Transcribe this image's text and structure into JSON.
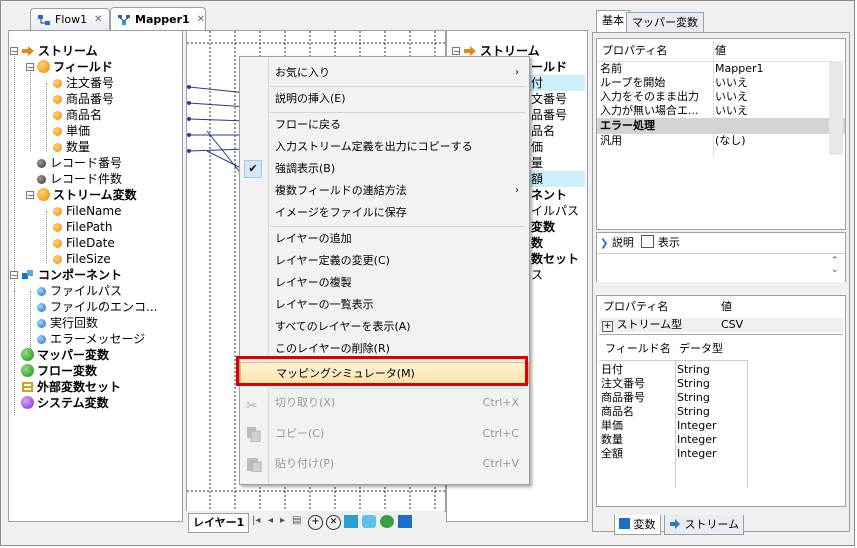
{
  "tabs": [
    {
      "label": "Flow1",
      "active": false
    },
    {
      "label": "Mapper1",
      "active": true
    }
  ],
  "left_tree": [
    {
      "label": "ストリーム",
      "bold": true
    },
    {
      "label": "フィールド",
      "bold": true
    },
    {
      "label": "注文番号"
    },
    {
      "label": "商品番号"
    },
    {
      "label": "商品名"
    },
    {
      "label": "単価"
    },
    {
      "label": "数量"
    },
    {
      "label": "レコード番号"
    },
    {
      "label": "レコード件数"
    },
    {
      "label": "ストリーム変数",
      "bold": true
    },
    {
      "label": "FileName"
    },
    {
      "label": "FilePath"
    },
    {
      "label": "FileDate"
    },
    {
      "label": "FileSize"
    },
    {
      "label": "コンポーネント",
      "bold": true
    },
    {
      "label": "ファイルパス"
    },
    {
      "label": "ファイルのエンコ..."
    },
    {
      "label": "実行回数"
    },
    {
      "label": "エラーメッセージ"
    },
    {
      "label": "マッパー変数",
      "bold": true
    },
    {
      "label": "フロー変数",
      "bold": true
    },
    {
      "label": "外部変数セット",
      "bold": true
    },
    {
      "label": "システム変数",
      "bold": true
    }
  ],
  "right_tree": [
    {
      "label": "ストリーム",
      "bold": true
    },
    {
      "label": "ールド",
      "bold": true
    },
    {
      "label": "付"
    },
    {
      "label": "文番号"
    },
    {
      "label": "品番号"
    },
    {
      "label": "品名"
    },
    {
      "label": "価"
    },
    {
      "label": "量"
    },
    {
      "label": "額"
    },
    {
      "label": "ネント",
      "bold": true
    },
    {
      "label": "イルパス"
    },
    {
      "label": "変数",
      "bold": true
    },
    {
      "label": "数",
      "bold": true
    },
    {
      "label": "数セット",
      "bold": true
    },
    {
      "label": "ス"
    }
  ],
  "context_menu": {
    "items": [
      {
        "label": "お気に入り",
        "submenu": true
      },
      {
        "sep": true
      },
      {
        "label": "説明の挿入(E)"
      },
      {
        "sep": true
      },
      {
        "label": "フローに戻る"
      },
      {
        "label": "入力ストリーム定義を出力にコピーする"
      },
      {
        "label": "強調表示(B)",
        "checked": true
      },
      {
        "label": "複数フィールドの連結方法",
        "submenu": true
      },
      {
        "label": "イメージをファイルに保存"
      },
      {
        "sep": true
      },
      {
        "label": "レイヤーの追加"
      },
      {
        "label": "レイヤー定義の変更(C)"
      },
      {
        "label": "レイヤーの複製"
      },
      {
        "label": "レイヤーの一覧表示"
      },
      {
        "label": "すべてのレイヤーを表示(A)"
      },
      {
        "label": "このレイヤーの削除(R)"
      },
      {
        "sep": true
      },
      {
        "label": "マッピングシミュレータ(M)",
        "highlighted": true
      },
      {
        "sep": true
      },
      {
        "label": "切り取り(X)",
        "shortcut": "Ctrl+X",
        "disabled": true
      },
      {
        "label": "コピー(C)",
        "shortcut": "Ctrl+C",
        "disabled": true
      },
      {
        "label": "貼り付け(P)",
        "shortcut": "Ctrl+V",
        "disabled": true
      }
    ]
  },
  "layer_tab": {
    "label": "レイヤー1"
  },
  "prop_tabs": [
    "基本",
    "マッパー変数"
  ],
  "prop_grid": {
    "header": {
      "name": "プロパティ名",
      "value": "値"
    },
    "rows": [
      {
        "k": "名前",
        "v": "Mapper1"
      },
      {
        "k": "ループを開始",
        "v": "いいえ"
      },
      {
        "k": "入力をそのまま出力",
        "v": "いいえ"
      },
      {
        "k": "入力が無い場合エ...",
        "v": "いいえ"
      },
      {
        "k": "エラー処理",
        "v": "",
        "section": true
      },
      {
        "k": "汎用",
        "v": "(なし)"
      }
    ]
  },
  "description": {
    "label": "説明",
    "show_label": "表示"
  },
  "stream_panel": {
    "header": {
      "name": "プロパティ名",
      "value": "値"
    },
    "stream_type_label": "ストリーム型",
    "stream_type_value": "CSV",
    "field_header": {
      "name": "フィールド名",
      "type": "データ型"
    },
    "fields": [
      {
        "name": "日付",
        "type": "String"
      },
      {
        "name": "注文番号",
        "type": "String"
      },
      {
        "name": "商品番号",
        "type": "String"
      },
      {
        "name": "商品名",
        "type": "String"
      },
      {
        "name": "単価",
        "type": "Integer"
      },
      {
        "name": "数量",
        "type": "Integer"
      },
      {
        "name": "全額",
        "type": "Integer"
      }
    ]
  },
  "bottom_tabs": [
    "変数",
    "ストリーム"
  ],
  "colors": {
    "highlight": "#fde4a8",
    "redbox": "#e00000",
    "selection": "#cfeefc"
  }
}
